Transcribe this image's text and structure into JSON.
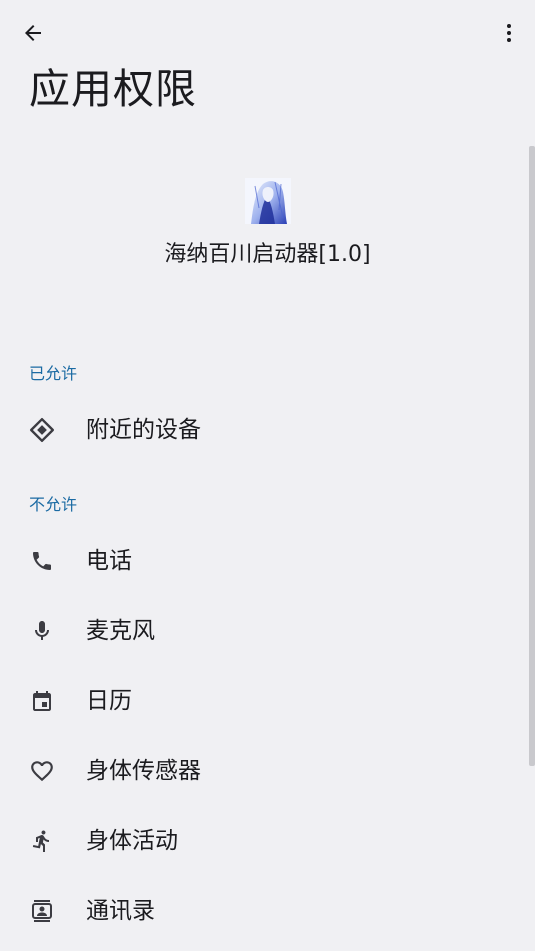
{
  "header": {
    "title": "应用权限",
    "back_icon": "arrow-back-icon",
    "more_icon": "more-vert-icon"
  },
  "app": {
    "name": "海纳百川启动器[1.0]",
    "icon": "app-avatar-icon"
  },
  "sections": {
    "allowed_label": "已允许",
    "denied_label": "不允许"
  },
  "allowed_items": [
    {
      "label": "附近的设备",
      "icon": "nearby-devices-icon"
    }
  ],
  "denied_items": [
    {
      "label": "电话",
      "icon": "phone-icon"
    },
    {
      "label": "麦克风",
      "icon": "microphone-icon"
    },
    {
      "label": "日历",
      "icon": "calendar-icon"
    },
    {
      "label": "身体传感器",
      "icon": "heart-icon"
    },
    {
      "label": "身体活动",
      "icon": "running-icon"
    },
    {
      "label": "通讯录",
      "icon": "contacts-icon"
    }
  ],
  "colors": {
    "background": "#f0f0f3",
    "section_label": "#1a6aa3",
    "text": "#1b1b1f",
    "icon": "#3c3c42"
  }
}
